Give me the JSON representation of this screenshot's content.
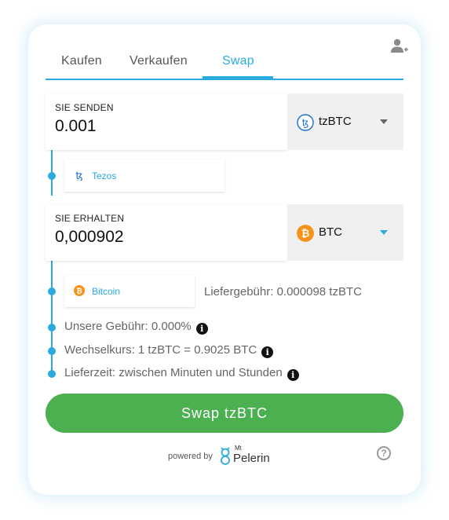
{
  "tabs": [
    {
      "label": "Kaufen"
    },
    {
      "label": "Verkaufen"
    },
    {
      "label": "Swap"
    }
  ],
  "send": {
    "label": "SIE SENDEN",
    "amount": "0.001",
    "currency": "tzBTC",
    "currency_icon": "tzbtc-icon",
    "network": "Tezos",
    "network_icon": "tezos-icon"
  },
  "receive": {
    "label": "SIE ERHALTEN",
    "amount": "0,000902",
    "currency": "BTC",
    "currency_icon": "bitcoin-icon",
    "network": "Bitcoin",
    "network_icon": "bitcoin-icon"
  },
  "delivery_fee": "Liefergebühr: 0.000098 tzBTC",
  "info": {
    "our_fee": "Unsere Gebühr: 0.000%",
    "exchange_rate": "Wechselkurs: 1 tzBTC = 0.9025 BTC",
    "delivery_time": "Lieferzeit: zwischen Minuten und Stunden"
  },
  "swap_button": "Swap tzBTC",
  "footer": {
    "powered_by": "powered by",
    "brand_mt": "Mt",
    "brand_name": "Pelerin"
  },
  "colors": {
    "accent": "#29abe2",
    "button": "#4caf50",
    "bitcoin": "#f7931a"
  }
}
